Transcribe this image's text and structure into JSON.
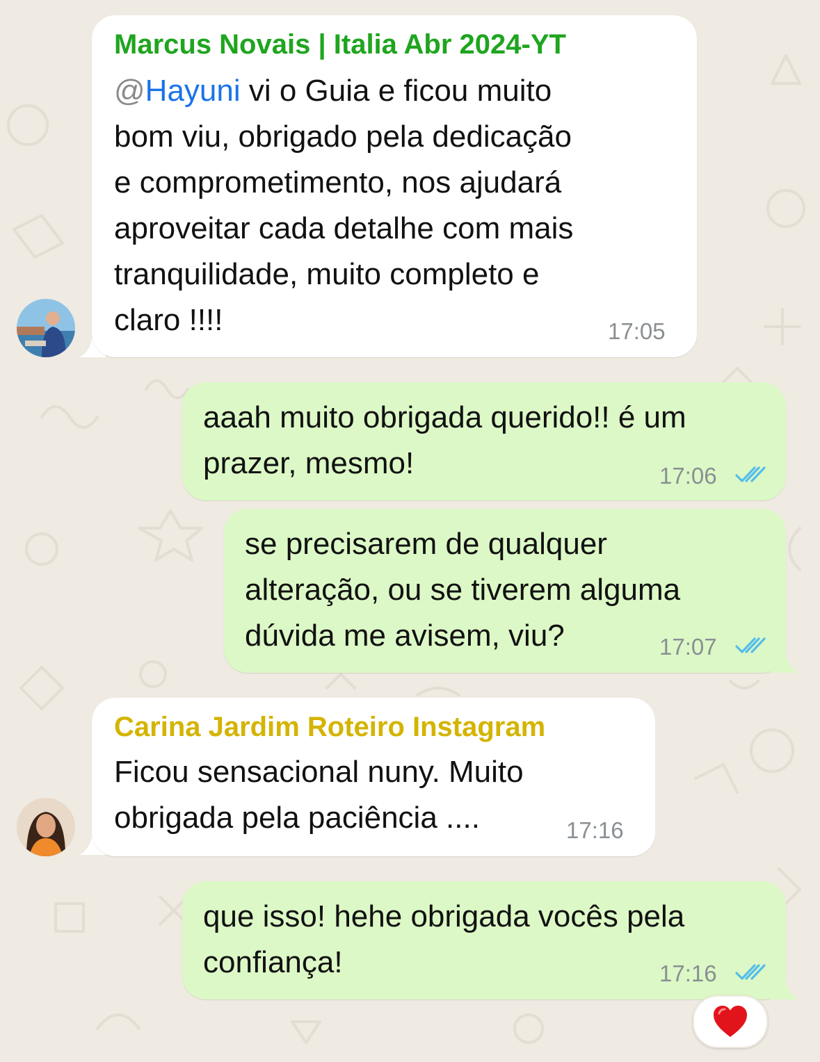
{
  "colors": {
    "background": "#efeae2",
    "incoming_bubble": "#ffffff",
    "outgoing_bubble": "#dcf8c6",
    "sender_marcus": "#1fa51f",
    "sender_carina": "#d4b400",
    "mention": "#1a73e8",
    "read_ticks": "#53bdeb"
  },
  "messages": [
    {
      "direction": "incoming",
      "sender": "Marcus Novais | Italia Abr 2024-YT",
      "mention_at": "@",
      "mention_name": "Hayuni",
      "lines": [
        " vi o Guia e ficou muito",
        "bom viu, obrigado pela dedicação",
        "e comprometimento, nos ajudará",
        "aproveitar cada detalhe com mais",
        "tranquilidade, muito completo e",
        "claro !!!!"
      ],
      "time": "17:05",
      "avatar_icon": "avatar-marcus"
    },
    {
      "direction": "outgoing",
      "lines": [
        "aaah muito obrigada querido!! é um",
        "prazer, mesmo!"
      ],
      "time": "17:06",
      "status_icon": "double-check-read-icon"
    },
    {
      "direction": "outgoing",
      "lines": [
        "se precisarem de qualquer",
        "alteração, ou se tiverem alguma",
        "dúvida me avisem, viu?"
      ],
      "time": "17:07",
      "status_icon": "double-check-read-icon"
    },
    {
      "direction": "incoming",
      "sender": "Carina Jardim Roteiro Instagram",
      "lines": [
        "Ficou sensacional nuny. Muito",
        "obrigada pela paciência ...."
      ],
      "time": "17:16",
      "avatar_icon": "avatar-carina"
    },
    {
      "direction": "outgoing",
      "lines": [
        "que isso! hehe obrigada vocês pela",
        "confiança!"
      ],
      "time": "17:16",
      "status_icon": "double-check-read-icon",
      "reaction": "❤️"
    }
  ]
}
